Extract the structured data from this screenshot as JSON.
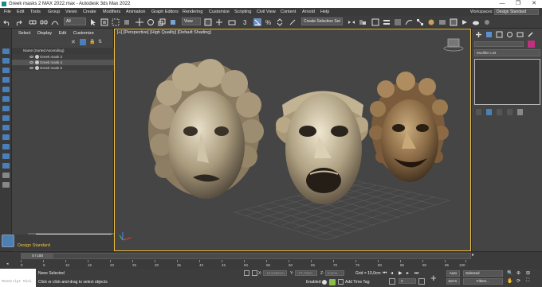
{
  "window": {
    "title": "Greek masks 2 MAX 2022.max - Autodesk 3ds Max 2022",
    "minimize": "—",
    "maximize": "❐",
    "close": "✕"
  },
  "menu": {
    "items": [
      "File",
      "Edit",
      "Tools",
      "Group",
      "Views",
      "Create",
      "Modifiers",
      "Animation",
      "Graph Editors",
      "Rendering",
      "Customize",
      "Scripting",
      "Civil View",
      "Content",
      "Arnold",
      "Help"
    ],
    "workspaces_label": "Workspaces:",
    "workspace_value": "Design Standard"
  },
  "toolbar": {
    "filter_value": "All",
    "view_value": "View",
    "selection_set": "Create Selection Set"
  },
  "scene_explorer": {
    "tabs": [
      "Select",
      "Display",
      "Edit",
      "Customize"
    ],
    "column_header": "Name (Sorted Ascending)",
    "items": [
      "Greek mask 3",
      "Greek mask 4",
      "Greek mask 5"
    ]
  },
  "layer": {
    "name": "Design Standard"
  },
  "viewport": {
    "label": "[+] [Perspective] [High Quality] [Default Shading]"
  },
  "command_panel": {
    "modifier_list": "Modifier List"
  },
  "timeline": {
    "frame_display": "0 / 100",
    "ticks": [
      "0",
      "5",
      "10",
      "15",
      "20",
      "25",
      "30",
      "35",
      "40",
      "45",
      "50",
      "55",
      "60",
      "65",
      "70",
      "75",
      "80",
      "85",
      "90",
      "95",
      "100"
    ]
  },
  "status": {
    "maxscript_label": "MAXScript Mini",
    "selection": "None Selected",
    "prompt": "Click or click-and-drag to select objects",
    "x_label": "X:",
    "x_value": "-144,562cm",
    "y_label": "Y:",
    "y_value": "-77,74cm",
    "z_label": "Z:",
    "z_value": "0,0cm",
    "grid": "Grid = 10,0cm",
    "enabled": "Enabled:",
    "add_time_tag": "Add Time Tag",
    "auto": "Auto",
    "set_k": "Set K.",
    "selected_dropdown": "Selected",
    "filters": "Filters...",
    "frame_value": "0"
  },
  "colors": {
    "accent_yellow": "#f0c040",
    "icon_blue": "#4a7fb8"
  }
}
